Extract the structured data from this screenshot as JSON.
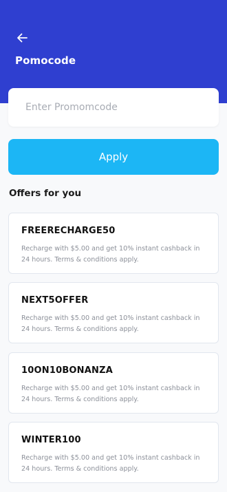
{
  "header": {
    "back_icon": "arrow-left-icon",
    "title": "Pomocode",
    "background": "#2f3fd0"
  },
  "promo": {
    "placeholder": "Enter Promomcode",
    "value": ""
  },
  "apply": {
    "label": "Apply",
    "color": "#1cb6f5"
  },
  "offers_section": {
    "title": "Offers for you"
  },
  "offers": [
    {
      "code": "FREERECHARGE50",
      "description": "Recharge with $5.00 and get 10% instant cashback in 24 hours. Terms & conditions apply."
    },
    {
      "code": "NEXT5OFFER",
      "description": "Recharge with $5.00 and get 10% instant cashback in 24 hours. Terms & conditions apply."
    },
    {
      "code": "10ON10BONANZA",
      "description": "Recharge with $5.00 and get 10% instant cashback in 24 hours. Terms & conditions apply."
    },
    {
      "code": "WINTER100",
      "description": "Recharge with $5.00 and get 10% instant cashback in 24 hours. Terms & conditions apply."
    }
  ]
}
